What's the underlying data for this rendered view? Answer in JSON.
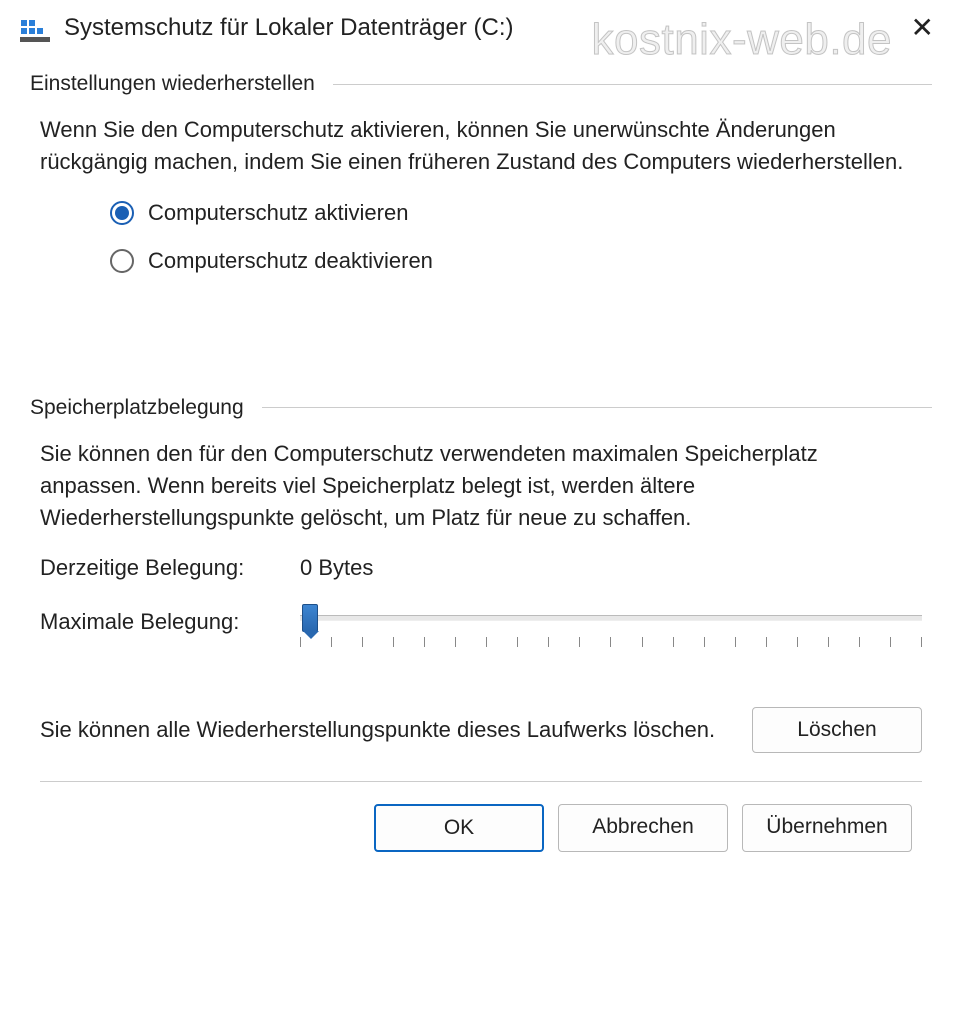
{
  "watermark": "kostnix-web.de",
  "title": "Systemschutz für Lokaler Datenträger (C:)",
  "restore": {
    "heading": "Einstellungen wiederherstellen",
    "desc": "Wenn Sie den Computerschutz aktivieren, können Sie unerwünschte Änderungen rückgängig machen, indem Sie einen früheren Zustand des Computers wiederherstellen.",
    "options": {
      "enable": "Computerschutz aktivieren",
      "disable": "Computerschutz deaktivieren"
    },
    "selected": "enable"
  },
  "diskspace": {
    "heading": "Speicherplatzbelegung",
    "desc": "Sie können den für den Computerschutz verwendeten maximalen Speicherplatz anpassen. Wenn bereits viel Speicherplatz belegt ist, werden ältere Wiederherstellungspunkte gelöscht, um Platz für neue zu schaffen.",
    "current_label": "Derzeitige Belegung:",
    "current_value": "0 Bytes",
    "max_label": "Maximale Belegung:",
    "slider_position_percent": 1
  },
  "delete": {
    "text": "Sie können alle Wiederherstellungspunkte dieses Laufwerks löschen.",
    "button": "Löschen"
  },
  "footer": {
    "ok": "OK",
    "cancel": "Abbrechen",
    "apply": "Übernehmen"
  }
}
